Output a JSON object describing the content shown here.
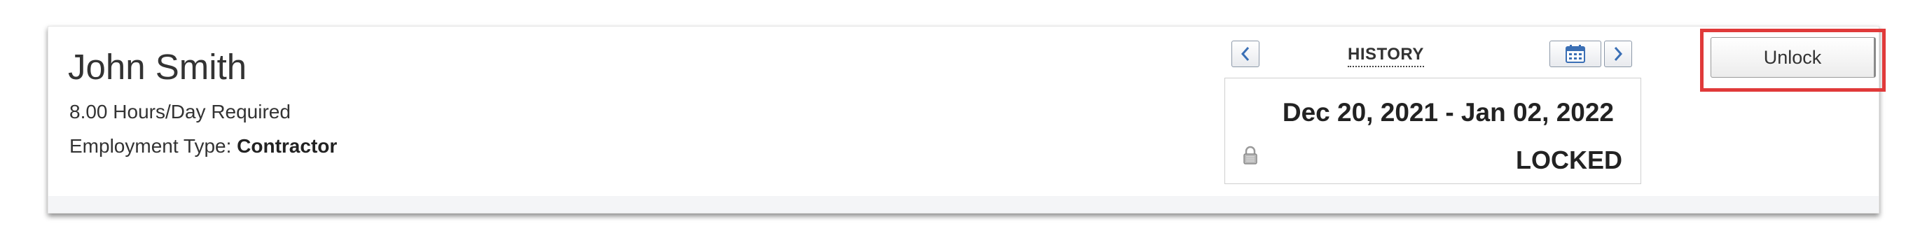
{
  "employee": {
    "name": "John Smith",
    "hours_required": "8.00 Hours/Day Required",
    "employment_type_label": "Employment Type:",
    "employment_type_value": "Contractor"
  },
  "period_nav": {
    "history_label": "HISTORY",
    "prev_icon": "chevron-left-icon",
    "next_icon": "chevron-right-icon",
    "calendar_icon": "calendar-icon"
  },
  "period": {
    "date_range": "Dec 20, 2021 - Jan 02, 2022",
    "status": "LOCKED",
    "status_icon": "lock-icon"
  },
  "actions": {
    "unlock_label": "Unlock"
  },
  "colors": {
    "highlight": "#e03a3a",
    "nav_icon": "#3a6fb5"
  }
}
